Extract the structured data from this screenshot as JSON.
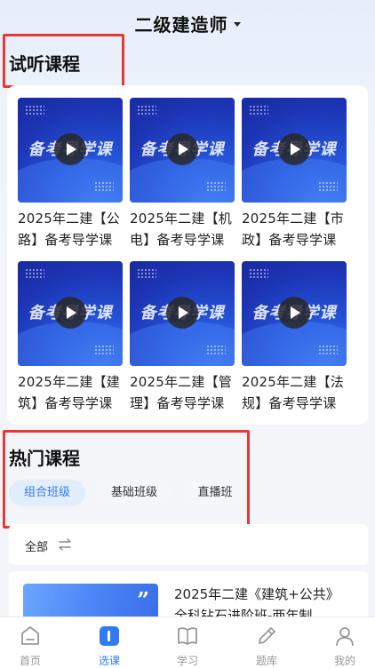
{
  "header": {
    "title": "二级建造师"
  },
  "trial": {
    "title": "试听课程",
    "thumb_text": "备考导学课",
    "courses": [
      {
        "line1": "2025年二建【公",
        "line2": "路】备考导学课"
      },
      {
        "line1": "2025年二建【机",
        "line2": "电】备考导学课"
      },
      {
        "line1": "2025年二建【市",
        "line2": "政】备考导学课"
      },
      {
        "line1": "2025年二建【建",
        "line2": "筑】备考导学课"
      },
      {
        "line1": "2025年二建【管",
        "line2": "理】备考导学课"
      },
      {
        "line1": "2025年二建【法",
        "line2": "规】备考导学课"
      }
    ]
  },
  "hot": {
    "title": "热门课程",
    "tabs": [
      "组合班级",
      "基础班级",
      "直播班"
    ],
    "active_tab": "组合班级"
  },
  "filter": {
    "label": "全部"
  },
  "list_item": {
    "line1": "2025年二建《建筑+公共》",
    "line2": "全科钻石进阶班-两年制"
  },
  "bottom_nav": [
    {
      "label": "首页",
      "icon": "home-icon"
    },
    {
      "label": "选课",
      "icon": "course-select-icon"
    },
    {
      "label": "学习",
      "icon": "book-icon"
    },
    {
      "label": "题库",
      "icon": "pen-icon"
    },
    {
      "label": "我的",
      "icon": "profile-icon"
    }
  ],
  "colors": {
    "accent": "#2f7cf6",
    "annotation": "#e53935"
  }
}
